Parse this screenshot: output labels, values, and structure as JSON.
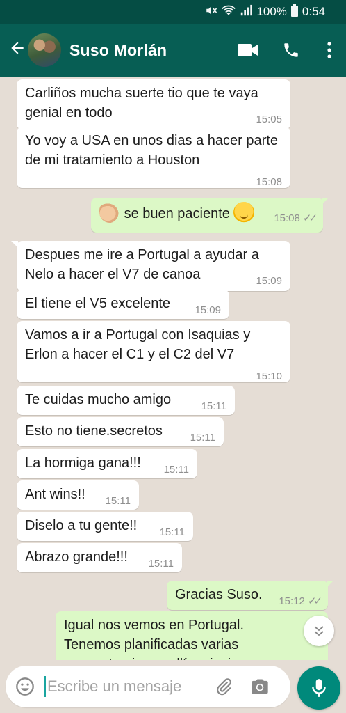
{
  "status_bar": {
    "battery": "100%",
    "time": "0:54"
  },
  "header": {
    "contact_name": "Suso Morlán"
  },
  "messages": [
    {
      "dir": "in",
      "text": "Carliños mucha suerte tio que te vaya genial en todo",
      "time": "15:05"
    },
    {
      "dir": "in",
      "text": "Yo voy a USA en unos dias a hacer parte de mi tratamiento a Houston",
      "time": "15:08"
    },
    {
      "dir": "out",
      "text": "se buen paciente",
      "time": "15:08",
      "emoji_before": "flexed-biceps-emoji",
      "emoji_after": "smirking-face-emoji"
    },
    {
      "dir": "in",
      "text": "Despues me ire a Portugal a ayudar a Nelo a hacer el V7 de canoa",
      "time": "15:09"
    },
    {
      "dir": "in",
      "text": "El tiene el V5 excelente",
      "time": "15:09"
    },
    {
      "dir": "in",
      "text": "Vamos a ir a Portugal con Isaquias y Erlon a hacer el C1 y el C2 del V7",
      "time": "15:10"
    },
    {
      "dir": "in",
      "text": "Te cuidas mucho amigo",
      "time": "15:11"
    },
    {
      "dir": "in",
      "text": "Esto no tiene.secretos",
      "time": "15:11"
    },
    {
      "dir": "in",
      "text": "La hormiga gana!!!",
      "time": "15:11"
    },
    {
      "dir": "in",
      "text": "Ant wins!!",
      "time": "15:11"
    },
    {
      "dir": "in",
      "text": "Diselo a tu gente!!",
      "time": "15:11"
    },
    {
      "dir": "in",
      "text": "Abrazo grande!!!",
      "time": "15:11"
    },
    {
      "dir": "out",
      "text": "Gracias Suso.",
      "time": "15:12"
    },
    {
      "dir": "out",
      "text": "Igual nos vemos en Portugal. Tenemos planificadas varias concentraciones allí en invierno",
      "time": ""
    }
  ],
  "composer": {
    "placeholder": "Escribe un mensaje"
  },
  "colors": {
    "header": "#075e54",
    "status_bar": "#054d44",
    "incoming": "#ffffff",
    "outgoing": "#dcf8c6",
    "mic_button": "#00897b",
    "chat_bg": "#e5ddd5"
  }
}
